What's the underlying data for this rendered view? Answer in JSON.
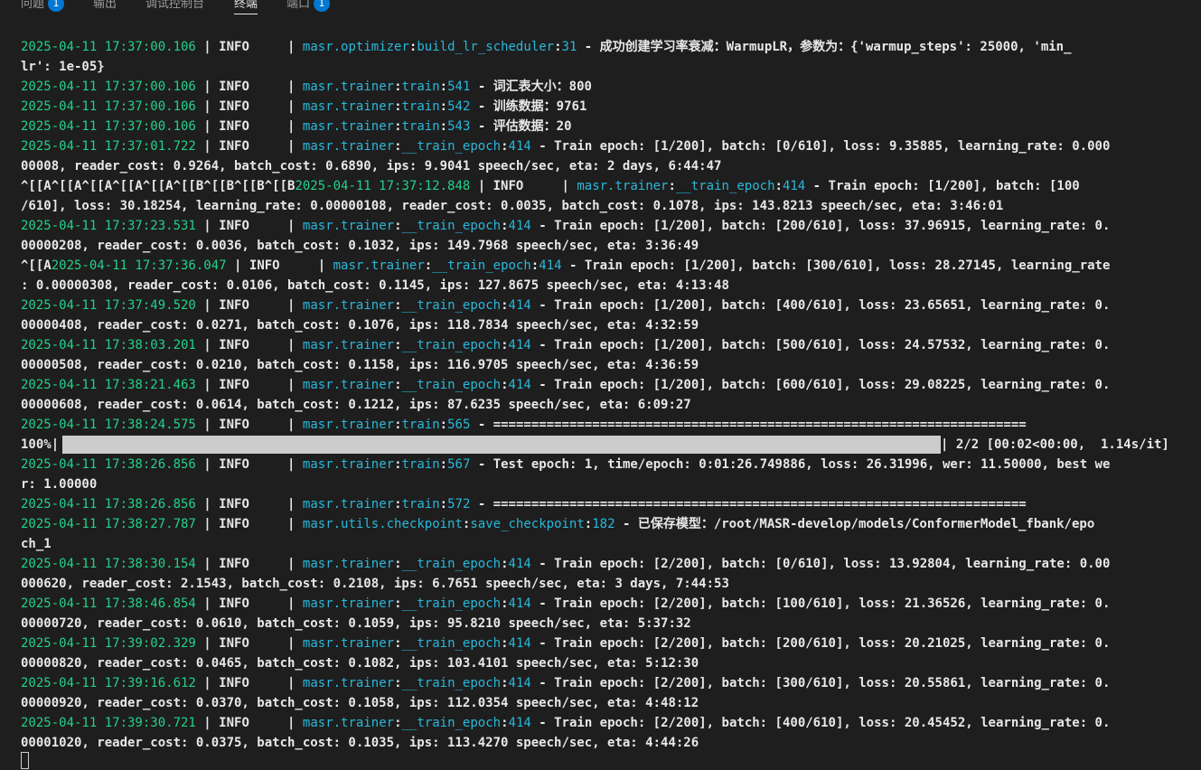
{
  "panel_tabs": [
    {
      "label": "问题",
      "badge": "1"
    },
    {
      "label": "输出"
    },
    {
      "label": "调试控制台"
    },
    {
      "label": "终端",
      "active": true
    },
    {
      "label": "端口",
      "badge": "1"
    }
  ],
  "log": [
    {
      "ts": "2025-04-11 17:37:00.106",
      "level": "INFO",
      "module": "masr.optimizer",
      "func": "build_lr_scheduler",
      "line": "31",
      "msg": "成功创建学习率衰减：WarmupLR，参数为：{'warmup_steps': 25000, 'min_",
      "cont": "lr': 1e-05}"
    },
    {
      "ts": "2025-04-11 17:37:00.106",
      "level": "INFO",
      "module": "masr.trainer",
      "func": "train",
      "line": "541",
      "msg": "词汇表大小：800"
    },
    {
      "ts": "2025-04-11 17:37:00.106",
      "level": "INFO",
      "module": "masr.trainer",
      "func": "train",
      "line": "542",
      "msg": "训练数据：9761"
    },
    {
      "ts": "2025-04-11 17:37:00.106",
      "level": "INFO",
      "module": "masr.trainer",
      "func": "train",
      "line": "543",
      "msg": "评估数据：20"
    },
    {
      "ts": "2025-04-11 17:37:01.722",
      "level": "INFO",
      "module": "masr.trainer",
      "func": "__train_epoch",
      "line": "414",
      "msg": "Train epoch: [1/200], batch: [0/610], loss: 9.35885, learning_rate: 0.000",
      "cont": "00008, reader_cost: 0.9264, batch_cost: 0.6890, ips: 9.9041 speech/sec, eta: 2 days, 6:44:47"
    },
    {
      "prefix": "^[[A^[[A^[[A^[[A^[[A^[[B^[[B^[[B^[[B",
      "ts": "2025-04-11 17:37:12.848",
      "level": "INFO",
      "module": "masr.trainer",
      "func": "__train_epoch",
      "line": "414",
      "msg": "Train epoch: [1/200], batch: [100",
      "cont": "/610], loss: 30.18254, learning_rate: 0.00000108, reader_cost: 0.0035, batch_cost: 0.1078, ips: 143.8213 speech/sec, eta: 3:46:01"
    },
    {
      "ts": "2025-04-11 17:37:23.531",
      "level": "INFO",
      "module": "masr.trainer",
      "func": "__train_epoch",
      "line": "414",
      "msg": "Train epoch: [1/200], batch: [200/610], loss: 37.96915, learning_rate: 0.",
      "cont": "00000208, reader_cost: 0.0036, batch_cost: 0.1032, ips: 149.7968 speech/sec, eta: 3:36:49"
    },
    {
      "prefix": "^[[A",
      "ts": "2025-04-11 17:37:36.047",
      "level": "INFO",
      "module": "masr.trainer",
      "func": "__train_epoch",
      "line": "414",
      "msg": "Train epoch: [1/200], batch: [300/610], loss: 28.27145, learning_rate",
      "cont": ": 0.00000308, reader_cost: 0.0106, batch_cost: 0.1145, ips: 127.8675 speech/sec, eta: 4:13:48"
    },
    {
      "ts": "2025-04-11 17:37:49.520",
      "level": "INFO",
      "module": "masr.trainer",
      "func": "__train_epoch",
      "line": "414",
      "msg": "Train epoch: [1/200], batch: [400/610], loss: 23.65651, learning_rate: 0.",
      "cont": "00000408, reader_cost: 0.0271, batch_cost: 0.1076, ips: 118.7834 speech/sec, eta: 4:32:59"
    },
    {
      "ts": "2025-04-11 17:38:03.201",
      "level": "INFO",
      "module": "masr.trainer",
      "func": "__train_epoch",
      "line": "414",
      "msg": "Train epoch: [1/200], batch: [500/610], loss: 24.57532, learning_rate: 0.",
      "cont": "00000508, reader_cost: 0.0210, batch_cost: 0.1158, ips: 116.9705 speech/sec, eta: 4:36:59"
    },
    {
      "ts": "2025-04-11 17:38:21.463",
      "level": "INFO",
      "module": "masr.trainer",
      "func": "__train_epoch",
      "line": "414",
      "msg": "Train epoch: [1/200], batch: [600/610], loss: 29.08225, learning_rate: 0.",
      "cont": "00000608, reader_cost: 0.0614, batch_cost: 0.1212, ips: 87.6235 speech/sec, eta: 6:09:27"
    },
    {
      "ts": "2025-04-11 17:38:24.575",
      "level": "INFO",
      "module": "masr.trainer",
      "func": "train",
      "line": "565",
      "msg": "======================================================================"
    },
    {
      "progress": true,
      "pct": "100%|",
      "fraction": 1.0,
      "stat": "| 2/2 [00:02<00:00,  1.14s/it]"
    },
    {
      "ts": "2025-04-11 17:38:26.856",
      "level": "INFO",
      "module": "masr.trainer",
      "func": "train",
      "line": "567",
      "msg": "Test epoch: 1, time/epoch: 0:01:26.749886, loss: 26.31996, wer: 11.50000, best we",
      "cont": "r: 1.00000"
    },
    {
      "ts": "2025-04-11 17:38:26.856",
      "level": "INFO",
      "module": "masr.trainer",
      "func": "train",
      "line": "572",
      "msg": "======================================================================"
    },
    {
      "ts": "2025-04-11 17:38:27.787",
      "level": "INFO",
      "module": "masr.utils.checkpoint",
      "func": "save_checkpoint",
      "line": "182",
      "msg": "已保存模型：/root/MASR-develop/models/ConformerModel_fbank/epo",
      "cont": "ch_1"
    },
    {
      "ts": "2025-04-11 17:38:30.154",
      "level": "INFO",
      "module": "masr.trainer",
      "func": "__train_epoch",
      "line": "414",
      "msg": "Train epoch: [2/200], batch: [0/610], loss: 13.92804, learning_rate: 0.00",
      "cont": "000620, reader_cost: 2.1543, batch_cost: 0.2108, ips: 6.7651 speech/sec, eta: 3 days, 7:44:53"
    },
    {
      "ts": "2025-04-11 17:38:46.854",
      "level": "INFO",
      "module": "masr.trainer",
      "func": "__train_epoch",
      "line": "414",
      "msg": "Train epoch: [2/200], batch: [100/610], loss: 21.36526, learning_rate: 0.",
      "cont": "00000720, reader_cost: 0.0610, batch_cost: 0.1059, ips: 95.8210 speech/sec, eta: 5:37:32"
    },
    {
      "ts": "2025-04-11 17:39:02.329",
      "level": "INFO",
      "module": "masr.trainer",
      "func": "__train_epoch",
      "line": "414",
      "msg": "Train epoch: [2/200], batch: [200/610], loss: 20.21025, learning_rate: 0.",
      "cont": "00000820, reader_cost: 0.0465, batch_cost: 0.1082, ips: 103.4101 speech/sec, eta: 5:12:30"
    },
    {
      "ts": "2025-04-11 17:39:16.612",
      "level": "INFO",
      "module": "masr.trainer",
      "func": "__train_epoch",
      "line": "414",
      "msg": "Train epoch: [2/200], batch: [300/610], loss: 20.55861, learning_rate: 0.",
      "cont": "00000920, reader_cost: 0.0370, batch_cost: 0.1058, ips: 112.0354 speech/sec, eta: 4:48:12"
    },
    {
      "ts": "2025-04-11 17:39:30.721",
      "level": "INFO",
      "module": "masr.trainer",
      "func": "__train_epoch",
      "line": "414",
      "msg": "Train epoch: [2/200], batch: [400/610], loss: 20.45452, learning_rate: 0.",
      "cont": "00001020, reader_cost: 0.0375, batch_cost: 0.1035, ips: 113.4270 speech/sec, eta: 4:44:26"
    }
  ],
  "colors": {
    "background": "#1e1e1e",
    "timestamp": "#23d18b",
    "module": "#29b8db",
    "text": "#e8e8e8",
    "badge": "#0078d4"
  }
}
